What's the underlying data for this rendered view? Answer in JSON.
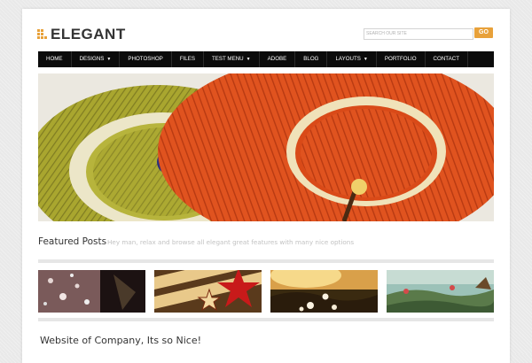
{
  "site": {
    "logo_text": "ELEGANT"
  },
  "search": {
    "placeholder": "SEARCH OUR SITE",
    "button_label": "GO"
  },
  "nav": {
    "items": [
      {
        "label": "HOME",
        "has_dropdown": false
      },
      {
        "label": "DESIGNS",
        "has_dropdown": true
      },
      {
        "label": "PHOTOSHOP",
        "has_dropdown": false
      },
      {
        "label": "FILES",
        "has_dropdown": false
      },
      {
        "label": "TEST MENU",
        "has_dropdown": true
      },
      {
        "label": "ADOBE",
        "has_dropdown": false
      },
      {
        "label": "BLOG",
        "has_dropdown": false
      },
      {
        "label": "LAYOUTS",
        "has_dropdown": true
      },
      {
        "label": "PORTFOLIO",
        "has_dropdown": false
      },
      {
        "label": "CONTACT",
        "has_dropdown": false
      }
    ],
    "caret_icon": "chevron-down-icon"
  },
  "featured": {
    "title": "Featured Posts",
    "subtitle": "Hey man, relax and browse all elegant great features with many nice options"
  },
  "section": {
    "title": "Website of Company, Its so Nice!"
  },
  "colors": {
    "accent": "#e8a13a",
    "nav_bg": "#0b0b0b",
    "text": "#333333"
  }
}
